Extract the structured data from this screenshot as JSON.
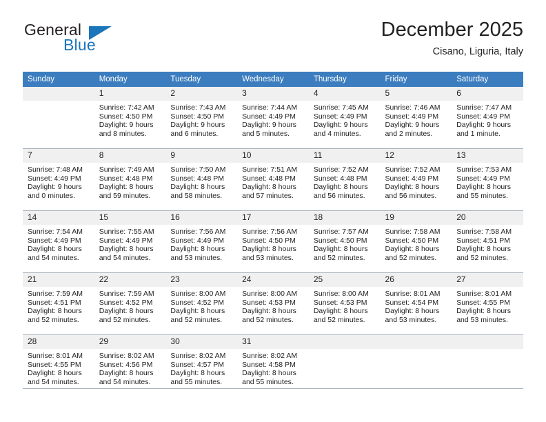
{
  "logo": {
    "word_one": "General",
    "word_two": "Blue",
    "triangle_color": "#1b75bb",
    "text_color": "#231f20"
  },
  "header": {
    "title": "December 2025",
    "subtitle": "Cisano, Liguria, Italy"
  },
  "theme": {
    "header_row_bg": "#3b7dbf",
    "header_row_text": "#ffffff",
    "daynum_bg": "#f0f0f0",
    "grid_line": "#a9b4bd"
  },
  "weekday_headers": [
    "Sunday",
    "Monday",
    "Tuesday",
    "Wednesday",
    "Thursday",
    "Friday",
    "Saturday"
  ],
  "weeks": [
    [
      {
        "day": "",
        "sunrise": "",
        "sunset": "",
        "daylight_line1": "",
        "daylight_line2": ""
      },
      {
        "day": "1",
        "sunrise": "Sunrise: 7:42 AM",
        "sunset": "Sunset: 4:50 PM",
        "daylight_line1": "Daylight: 9 hours",
        "daylight_line2": "and 8 minutes."
      },
      {
        "day": "2",
        "sunrise": "Sunrise: 7:43 AM",
        "sunset": "Sunset: 4:50 PM",
        "daylight_line1": "Daylight: 9 hours",
        "daylight_line2": "and 6 minutes."
      },
      {
        "day": "3",
        "sunrise": "Sunrise: 7:44 AM",
        "sunset": "Sunset: 4:49 PM",
        "daylight_line1": "Daylight: 9 hours",
        "daylight_line2": "and 5 minutes."
      },
      {
        "day": "4",
        "sunrise": "Sunrise: 7:45 AM",
        "sunset": "Sunset: 4:49 PM",
        "daylight_line1": "Daylight: 9 hours",
        "daylight_line2": "and 4 minutes."
      },
      {
        "day": "5",
        "sunrise": "Sunrise: 7:46 AM",
        "sunset": "Sunset: 4:49 PM",
        "daylight_line1": "Daylight: 9 hours",
        "daylight_line2": "and 2 minutes."
      },
      {
        "day": "6",
        "sunrise": "Sunrise: 7:47 AM",
        "sunset": "Sunset: 4:49 PM",
        "daylight_line1": "Daylight: 9 hours",
        "daylight_line2": "and 1 minute."
      }
    ],
    [
      {
        "day": "7",
        "sunrise": "Sunrise: 7:48 AM",
        "sunset": "Sunset: 4:49 PM",
        "daylight_line1": "Daylight: 9 hours",
        "daylight_line2": "and 0 minutes."
      },
      {
        "day": "8",
        "sunrise": "Sunrise: 7:49 AM",
        "sunset": "Sunset: 4:48 PM",
        "daylight_line1": "Daylight: 8 hours",
        "daylight_line2": "and 59 minutes."
      },
      {
        "day": "9",
        "sunrise": "Sunrise: 7:50 AM",
        "sunset": "Sunset: 4:48 PM",
        "daylight_line1": "Daylight: 8 hours",
        "daylight_line2": "and 58 minutes."
      },
      {
        "day": "10",
        "sunrise": "Sunrise: 7:51 AM",
        "sunset": "Sunset: 4:48 PM",
        "daylight_line1": "Daylight: 8 hours",
        "daylight_line2": "and 57 minutes."
      },
      {
        "day": "11",
        "sunrise": "Sunrise: 7:52 AM",
        "sunset": "Sunset: 4:48 PM",
        "daylight_line1": "Daylight: 8 hours",
        "daylight_line2": "and 56 minutes."
      },
      {
        "day": "12",
        "sunrise": "Sunrise: 7:52 AM",
        "sunset": "Sunset: 4:49 PM",
        "daylight_line1": "Daylight: 8 hours",
        "daylight_line2": "and 56 minutes."
      },
      {
        "day": "13",
        "sunrise": "Sunrise: 7:53 AM",
        "sunset": "Sunset: 4:49 PM",
        "daylight_line1": "Daylight: 8 hours",
        "daylight_line2": "and 55 minutes."
      }
    ],
    [
      {
        "day": "14",
        "sunrise": "Sunrise: 7:54 AM",
        "sunset": "Sunset: 4:49 PM",
        "daylight_line1": "Daylight: 8 hours",
        "daylight_line2": "and 54 minutes."
      },
      {
        "day": "15",
        "sunrise": "Sunrise: 7:55 AM",
        "sunset": "Sunset: 4:49 PM",
        "daylight_line1": "Daylight: 8 hours",
        "daylight_line2": "and 54 minutes."
      },
      {
        "day": "16",
        "sunrise": "Sunrise: 7:56 AM",
        "sunset": "Sunset: 4:49 PM",
        "daylight_line1": "Daylight: 8 hours",
        "daylight_line2": "and 53 minutes."
      },
      {
        "day": "17",
        "sunrise": "Sunrise: 7:56 AM",
        "sunset": "Sunset: 4:50 PM",
        "daylight_line1": "Daylight: 8 hours",
        "daylight_line2": "and 53 minutes."
      },
      {
        "day": "18",
        "sunrise": "Sunrise: 7:57 AM",
        "sunset": "Sunset: 4:50 PM",
        "daylight_line1": "Daylight: 8 hours",
        "daylight_line2": "and 52 minutes."
      },
      {
        "day": "19",
        "sunrise": "Sunrise: 7:58 AM",
        "sunset": "Sunset: 4:50 PM",
        "daylight_line1": "Daylight: 8 hours",
        "daylight_line2": "and 52 minutes."
      },
      {
        "day": "20",
        "sunrise": "Sunrise: 7:58 AM",
        "sunset": "Sunset: 4:51 PM",
        "daylight_line1": "Daylight: 8 hours",
        "daylight_line2": "and 52 minutes."
      }
    ],
    [
      {
        "day": "21",
        "sunrise": "Sunrise: 7:59 AM",
        "sunset": "Sunset: 4:51 PM",
        "daylight_line1": "Daylight: 8 hours",
        "daylight_line2": "and 52 minutes."
      },
      {
        "day": "22",
        "sunrise": "Sunrise: 7:59 AM",
        "sunset": "Sunset: 4:52 PM",
        "daylight_line1": "Daylight: 8 hours",
        "daylight_line2": "and 52 minutes."
      },
      {
        "day": "23",
        "sunrise": "Sunrise: 8:00 AM",
        "sunset": "Sunset: 4:52 PM",
        "daylight_line1": "Daylight: 8 hours",
        "daylight_line2": "and 52 minutes."
      },
      {
        "day": "24",
        "sunrise": "Sunrise: 8:00 AM",
        "sunset": "Sunset: 4:53 PM",
        "daylight_line1": "Daylight: 8 hours",
        "daylight_line2": "and 52 minutes."
      },
      {
        "day": "25",
        "sunrise": "Sunrise: 8:00 AM",
        "sunset": "Sunset: 4:53 PM",
        "daylight_line1": "Daylight: 8 hours",
        "daylight_line2": "and 52 minutes."
      },
      {
        "day": "26",
        "sunrise": "Sunrise: 8:01 AM",
        "sunset": "Sunset: 4:54 PM",
        "daylight_line1": "Daylight: 8 hours",
        "daylight_line2": "and 53 minutes."
      },
      {
        "day": "27",
        "sunrise": "Sunrise: 8:01 AM",
        "sunset": "Sunset: 4:55 PM",
        "daylight_line1": "Daylight: 8 hours",
        "daylight_line2": "and 53 minutes."
      }
    ],
    [
      {
        "day": "28",
        "sunrise": "Sunrise: 8:01 AM",
        "sunset": "Sunset: 4:55 PM",
        "daylight_line1": "Daylight: 8 hours",
        "daylight_line2": "and 54 minutes."
      },
      {
        "day": "29",
        "sunrise": "Sunrise: 8:02 AM",
        "sunset": "Sunset: 4:56 PM",
        "daylight_line1": "Daylight: 8 hours",
        "daylight_line2": "and 54 minutes."
      },
      {
        "day": "30",
        "sunrise": "Sunrise: 8:02 AM",
        "sunset": "Sunset: 4:57 PM",
        "daylight_line1": "Daylight: 8 hours",
        "daylight_line2": "and 55 minutes."
      },
      {
        "day": "31",
        "sunrise": "Sunrise: 8:02 AM",
        "sunset": "Sunset: 4:58 PM",
        "daylight_line1": "Daylight: 8 hours",
        "daylight_line2": "and 55 minutes."
      },
      {
        "day": "",
        "sunrise": "",
        "sunset": "",
        "daylight_line1": "",
        "daylight_line2": ""
      },
      {
        "day": "",
        "sunrise": "",
        "sunset": "",
        "daylight_line1": "",
        "daylight_line2": ""
      },
      {
        "day": "",
        "sunrise": "",
        "sunset": "",
        "daylight_line1": "",
        "daylight_line2": ""
      }
    ]
  ]
}
